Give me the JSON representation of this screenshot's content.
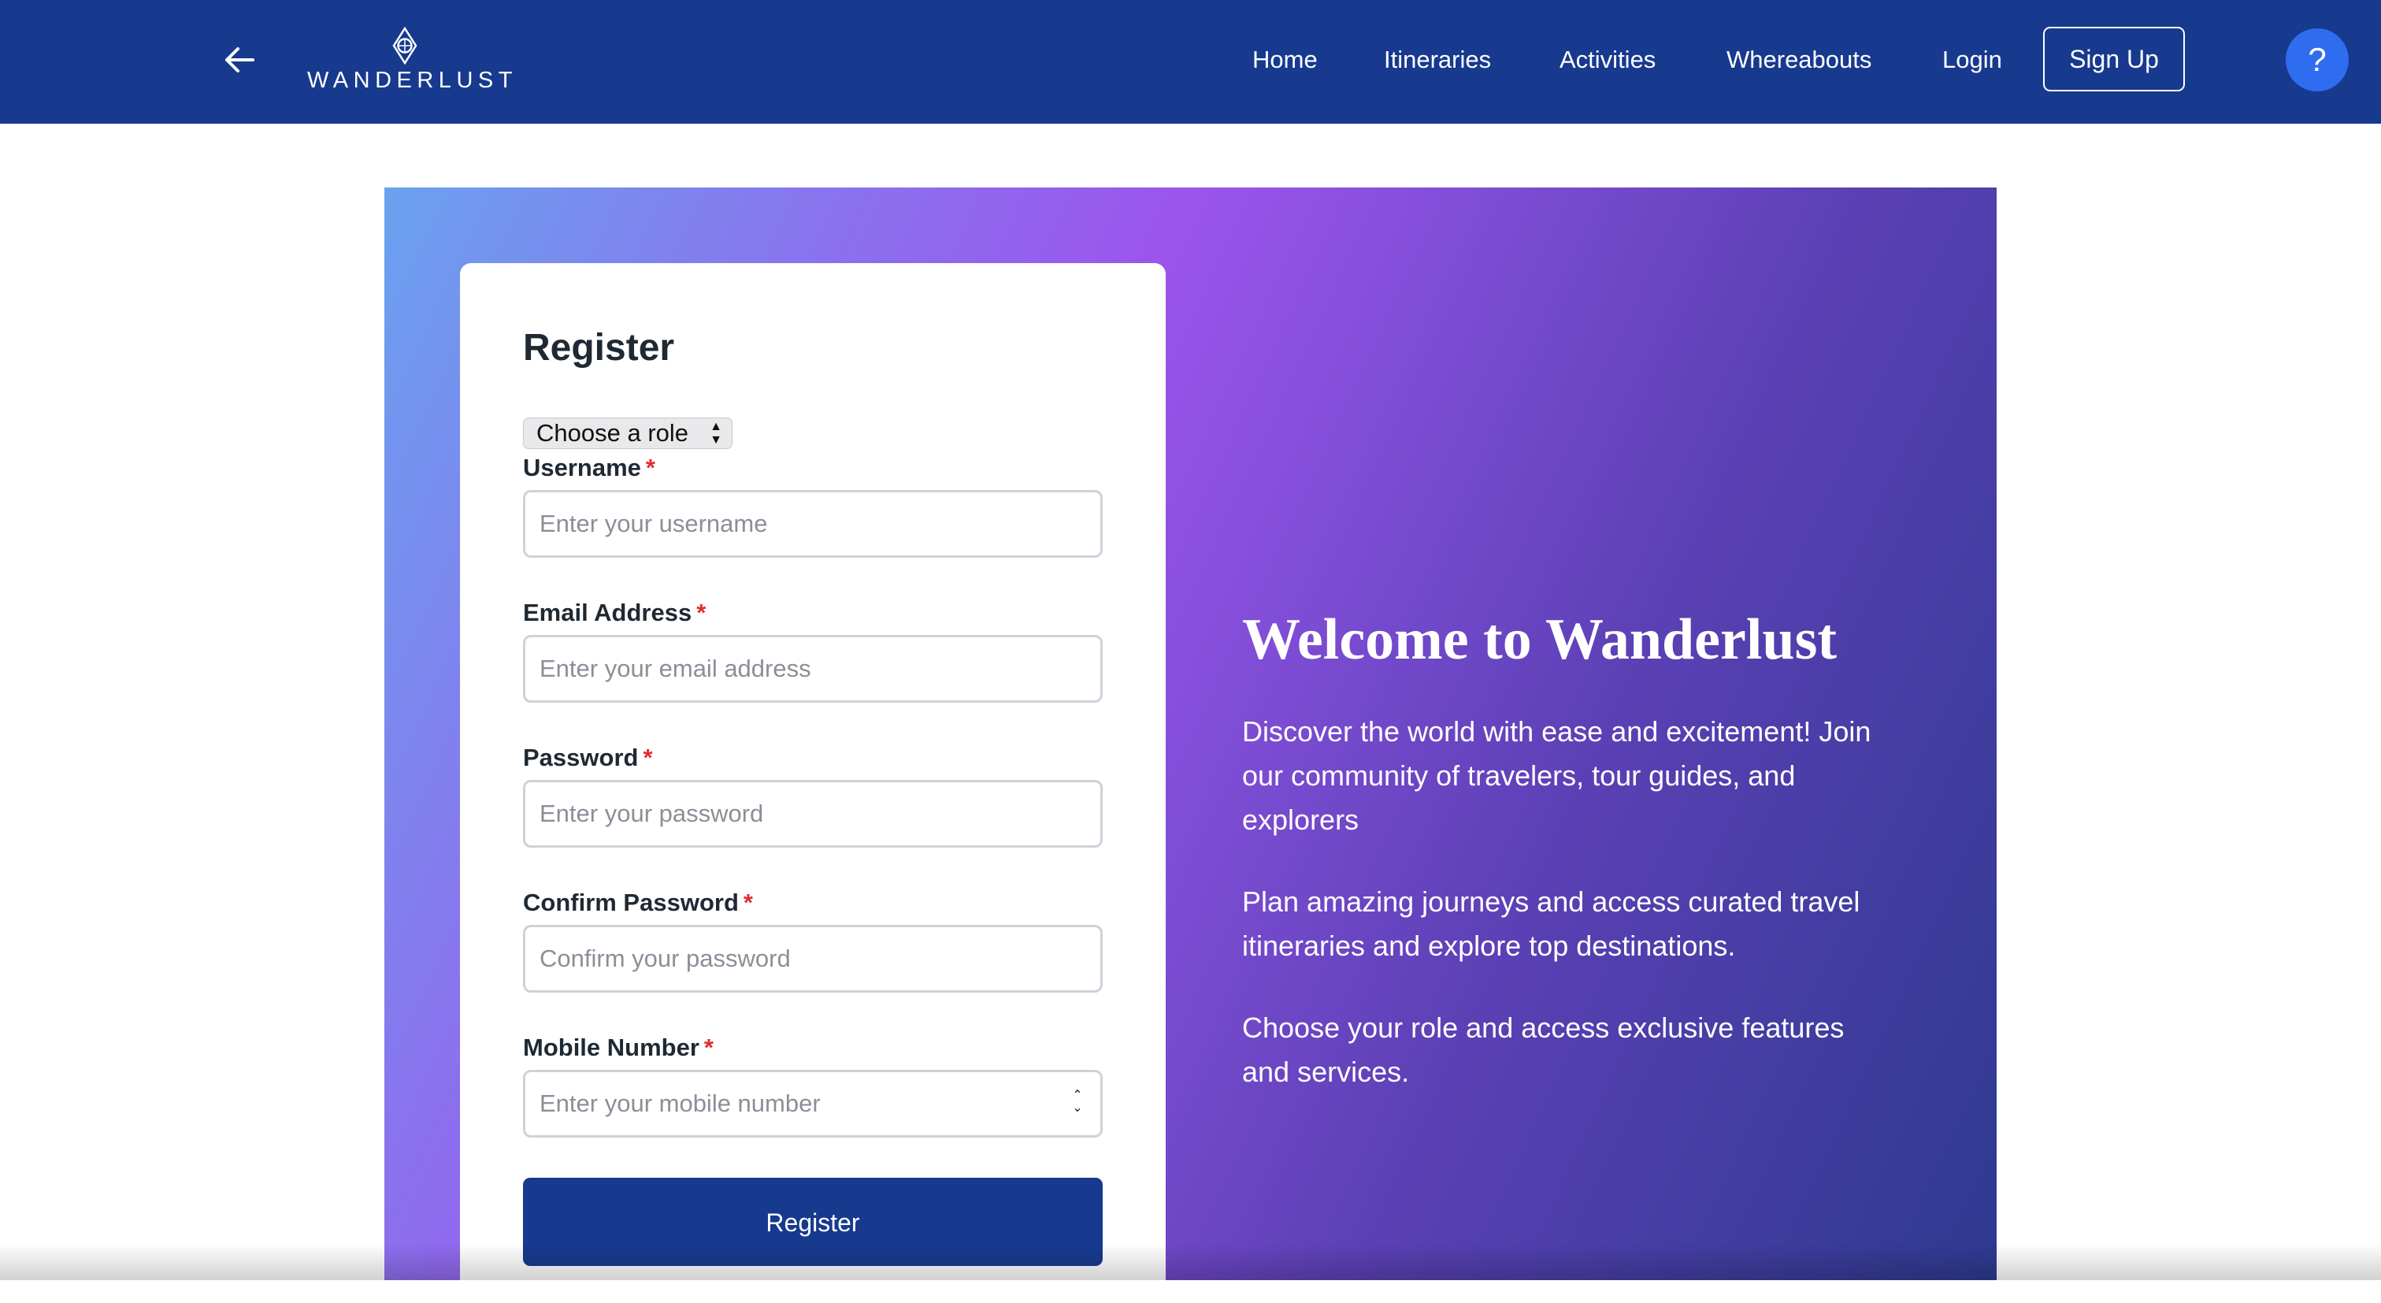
{
  "brand": {
    "name": "WANDERLUST",
    "logo_icon": "compass-diamond-icon"
  },
  "navbar": {
    "back_icon": "arrow-left-icon",
    "links": [
      "Home",
      "Itineraries",
      "Activities",
      "Whereabouts",
      "Login"
    ],
    "signup_label": "Sign Up",
    "help_label": "?"
  },
  "register": {
    "title": "Register",
    "role_select": {
      "selected": "Choose a role"
    },
    "fields": [
      {
        "label": "Username",
        "required_mark": "*",
        "placeholder": "Enter your username"
      },
      {
        "label": "Email Address",
        "required_mark": "*",
        "placeholder": "Enter your email address"
      },
      {
        "label": "Password",
        "required_mark": "*",
        "placeholder": "Enter your password"
      },
      {
        "label": "Confirm Password",
        "required_mark": "*",
        "placeholder": "Confirm your password"
      },
      {
        "label": "Mobile Number",
        "required_mark": "*",
        "placeholder": "Enter your mobile number"
      }
    ],
    "submit_label": "Register"
  },
  "welcome": {
    "title": "Welcome to Wanderlust",
    "paragraphs": [
      "Discover the world with ease and excitement! Join our community of travelers, tour guides, and explorers",
      "Plan amazing journeys and access curated travel itineraries and explore top destinations.",
      "Choose your role and access exclusive features and services."
    ]
  },
  "colors": {
    "navbar_bg": "#173a8f",
    "accent_button": "#173a8f",
    "help_button": "#2f6df0",
    "required_star": "#e02d2d"
  }
}
